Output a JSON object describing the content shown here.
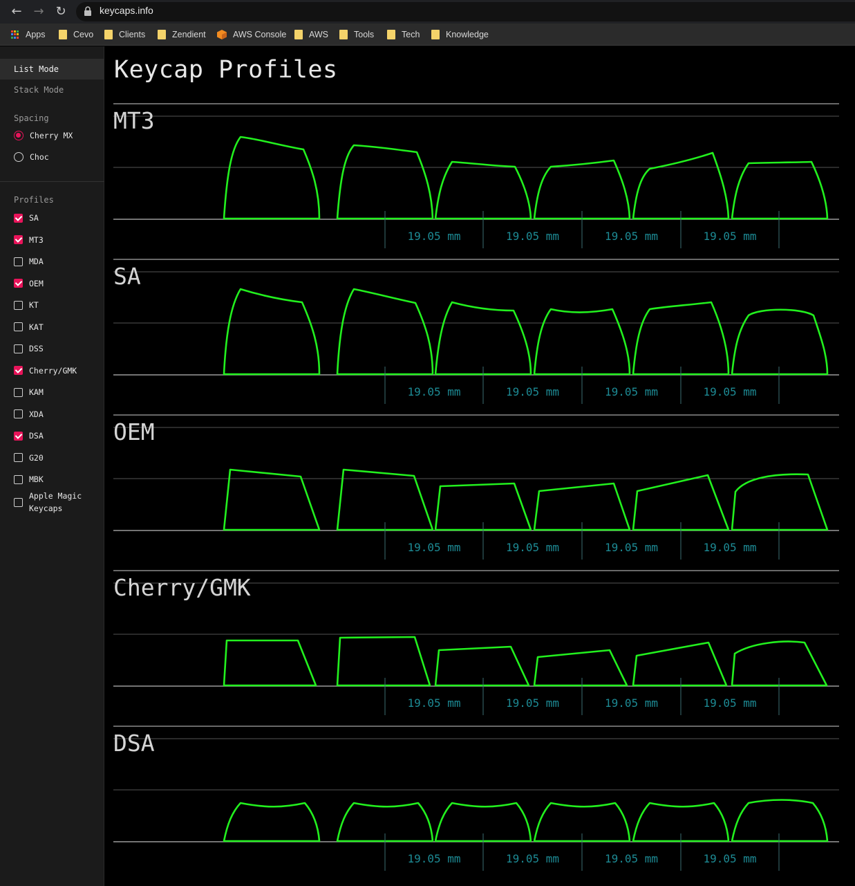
{
  "browser": {
    "url": "keycaps.info",
    "bookmarks": [
      {
        "label": "Apps",
        "icon": "apps-grid-icon"
      },
      {
        "label": "Cevo",
        "icon": "folder-icon"
      },
      {
        "label": "Clients",
        "icon": "folder-icon"
      },
      {
        "label": "Zendient",
        "icon": "folder-icon"
      },
      {
        "label": "AWS Console",
        "icon": "aws-cube-icon"
      },
      {
        "label": "AWS",
        "icon": "folder-icon"
      },
      {
        "label": "Tools",
        "icon": "folder-icon"
      },
      {
        "label": "Tech",
        "icon": "folder-icon"
      },
      {
        "label": "Knowledge",
        "icon": "folder-icon"
      }
    ]
  },
  "sidebar": {
    "modes": [
      {
        "label": "List Mode",
        "active": true
      },
      {
        "label": "Stack Mode",
        "active": false
      }
    ],
    "spacing_heading": "Spacing",
    "spacing_options": [
      {
        "label": "Cherry MX",
        "selected": true
      },
      {
        "label": "Choc",
        "selected": false
      }
    ],
    "profiles_heading": "Profiles",
    "profile_options": [
      {
        "label": "SA",
        "checked": true
      },
      {
        "label": "MT3",
        "checked": true
      },
      {
        "label": "MDA",
        "checked": false
      },
      {
        "label": "OEM",
        "checked": true
      },
      {
        "label": "KT",
        "checked": false
      },
      {
        "label": "KAT",
        "checked": false
      },
      {
        "label": "DSS",
        "checked": false
      },
      {
        "label": "Cherry/GMK",
        "checked": true
      },
      {
        "label": "KAM",
        "checked": false
      },
      {
        "label": "XDA",
        "checked": false
      },
      {
        "label": "DSA",
        "checked": true
      },
      {
        "label": "G20",
        "checked": false
      },
      {
        "label": "MBK",
        "checked": false
      },
      {
        "label": "Apple Magic\nKeycaps",
        "checked": false
      }
    ]
  },
  "main": {
    "title": "Keycap Profiles",
    "spacing_label": "19.05 mm",
    "profiles": [
      {
        "name": "MT3"
      },
      {
        "name": "SA"
      },
      {
        "name": "OEM"
      },
      {
        "name": "Cherry/GMK"
      },
      {
        "name": "DSA"
      }
    ]
  },
  "colors": {
    "accent": "#e8145a",
    "keycap_outline": "#22f01e",
    "dimension_text": "#1d8a94",
    "guide_lines": "#555555"
  }
}
